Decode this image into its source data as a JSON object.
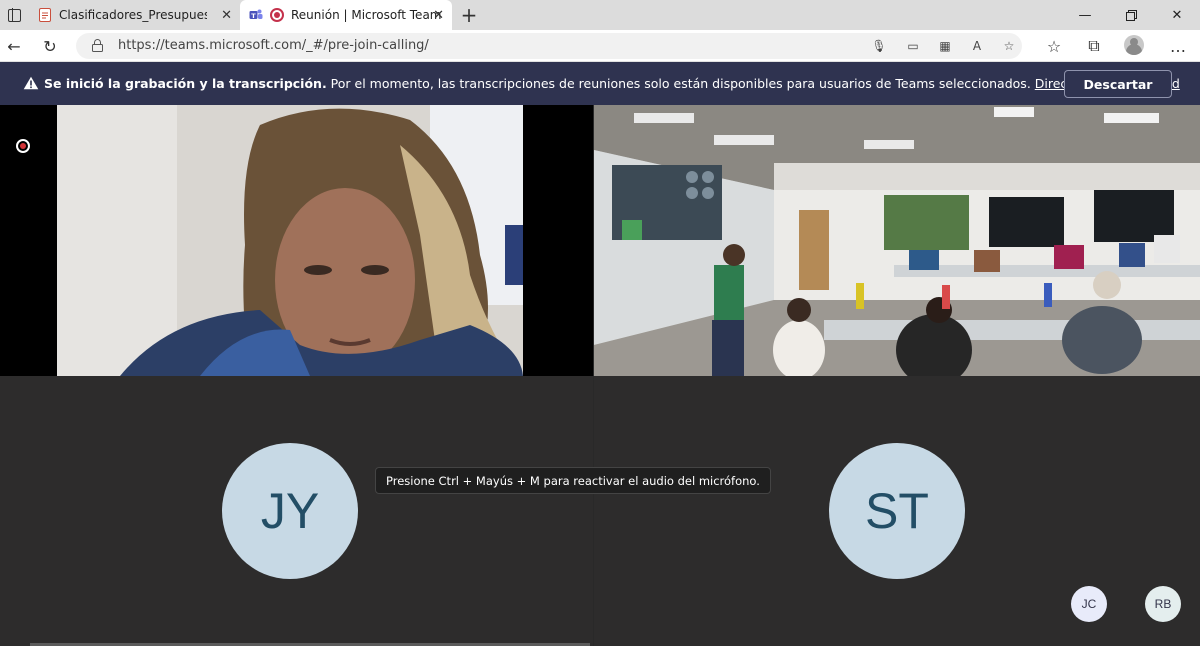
{
  "browser": {
    "tabs": [
      {
        "label": "Clasificadores_Presupuestarios_C",
        "active": false
      },
      {
        "label": "Reunión | Microsoft Teams",
        "active": true
      }
    ],
    "url": "https://teams.microsoft.com/_#/pre-join-calling/"
  },
  "banner": {
    "bold_text": "Se inició la grabación y la transcripción.",
    "text": " Por el momento, las transcripciones de reuniones solo están disponibles para usuarios de Teams seleccionados. ",
    "link": "Directiva de privacidad",
    "dismiss_label": "Descartar"
  },
  "meeting": {
    "participants": [
      {
        "initials": "JY"
      },
      {
        "initials": "ST"
      }
    ],
    "tooltip": "Presione Ctrl + Mayús + M para reactivar el audio del micrófono.",
    "overflow_participants": [
      {
        "initials": "JC"
      },
      {
        "initials": "RB"
      }
    ]
  },
  "colors": {
    "banner_bg": "#2f3350",
    "stage_bg": "#292929",
    "avatar_bg": "#c7d9e5",
    "record_red": "#d13438"
  }
}
